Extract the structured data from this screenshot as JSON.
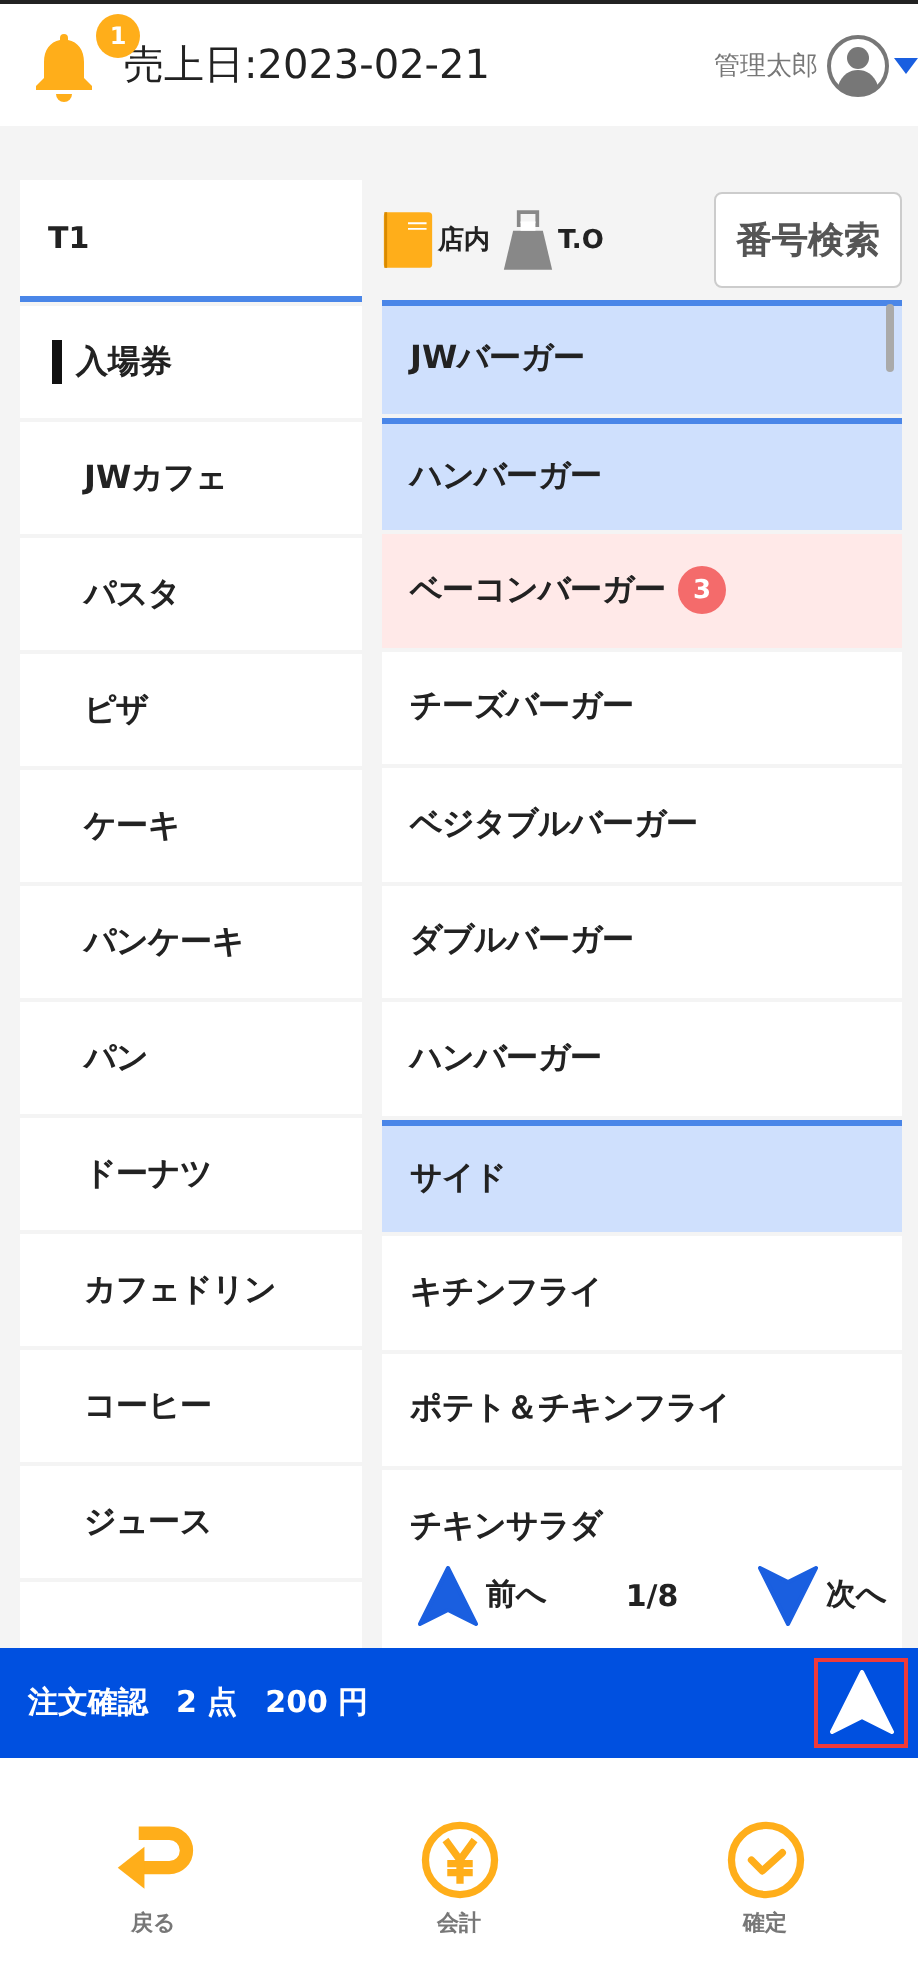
{
  "header": {
    "notification_count": "1",
    "sales_date": "売上日:2023-02-21",
    "user_name": "管理太郎"
  },
  "table_label": "T1",
  "categories": [
    {
      "label": "入場券",
      "selected": true
    },
    {
      "label": "JWカフェ",
      "selected": false
    },
    {
      "label": "パスタ",
      "selected": false
    },
    {
      "label": "ピザ",
      "selected": false
    },
    {
      "label": "ケーキ",
      "selected": false
    },
    {
      "label": "パンケーキ",
      "selected": false
    },
    {
      "label": "パン",
      "selected": false
    },
    {
      "label": "ドーナツ",
      "selected": false
    },
    {
      "label": "カフェドリン",
      "selected": false
    },
    {
      "label": "コーヒー",
      "selected": false
    },
    {
      "label": "ジュース",
      "selected": false
    }
  ],
  "order_type": {
    "dine_in": "店内",
    "take_out": "T.O",
    "dine_in_selected": true
  },
  "search_button": "番号検索",
  "items": [
    {
      "kind": "group",
      "label": "JWバーガー"
    },
    {
      "kind": "group",
      "label": "ハンバーガー"
    },
    {
      "kind": "item",
      "label": "ベーコンバーガー",
      "count": "3"
    },
    {
      "kind": "item",
      "label": "チーズバーガー"
    },
    {
      "kind": "item",
      "label": "ベジタブルバーガー"
    },
    {
      "kind": "item",
      "label": "ダブルバーガー"
    },
    {
      "kind": "item",
      "label": "ハンバーガー"
    },
    {
      "kind": "group",
      "label": "サイド"
    },
    {
      "kind": "item",
      "label": "キチンフライ"
    },
    {
      "kind": "item",
      "label": "ポテト＆チキンフライ"
    },
    {
      "kind": "item",
      "label": "チキンサラダ"
    }
  ],
  "pager": {
    "prev": "前へ",
    "page": "1/8",
    "next": "次へ"
  },
  "order_bar": {
    "title": "注文確認",
    "quantity": "2 点",
    "total": "200 円"
  },
  "nav": [
    {
      "kind": "back",
      "label": "戻る"
    },
    {
      "kind": "checkout",
      "label": "会計"
    },
    {
      "kind": "confirm",
      "label": "確定"
    }
  ]
}
